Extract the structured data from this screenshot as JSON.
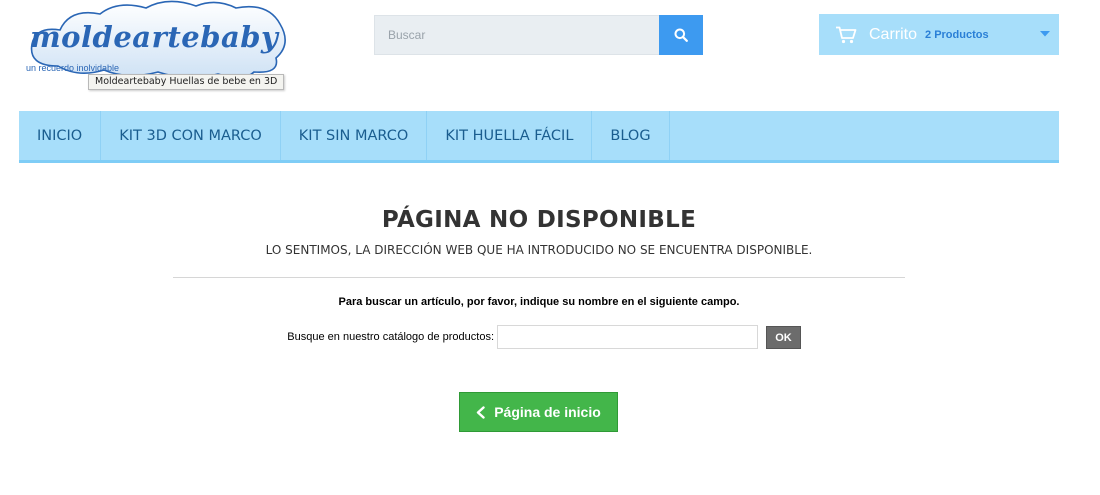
{
  "header": {
    "logo_text": "moldeartebaby",
    "logo_slogan": "un recuerdo inolvidable",
    "logo_tooltip": "Moldeartebaby Huellas de bebe en 3D",
    "search": {
      "placeholder": "Buscar",
      "icon": "search-icon"
    },
    "cart": {
      "label": "Carrito",
      "count_text": "2 Productos",
      "icon": "cart-icon",
      "caret_icon": "caret-down-icon"
    }
  },
  "nav": {
    "items": [
      {
        "label": "INICIO"
      },
      {
        "label": "KIT 3D CON MARCO"
      },
      {
        "label": "KIT SIN MARCO"
      },
      {
        "label": "KIT HUELLA FÁCIL"
      },
      {
        "label": "BLOG"
      }
    ]
  },
  "main": {
    "title": "PÁGINA NO DISPONIBLE",
    "subtitle": "LO SENTIMOS, LA DIRECCIÓN WEB QUE HA INTRODUCIDO NO SE ENCUENTRA DISPONIBLE.",
    "instruction": "Para buscar un artículo, por favor, indique su nombre en el siguiente campo.",
    "catalog_label": "Busque en nuestro catálogo de productos:",
    "catalog_value": "",
    "ok_label": "OK",
    "home_button_label": "Página de inicio"
  },
  "colors": {
    "nav_bg": "#a7defa",
    "nav_text": "#1a5d8f",
    "search_button": "#3d9af0",
    "home_button": "#43b64a",
    "logo_blue": "#2a66b5"
  }
}
